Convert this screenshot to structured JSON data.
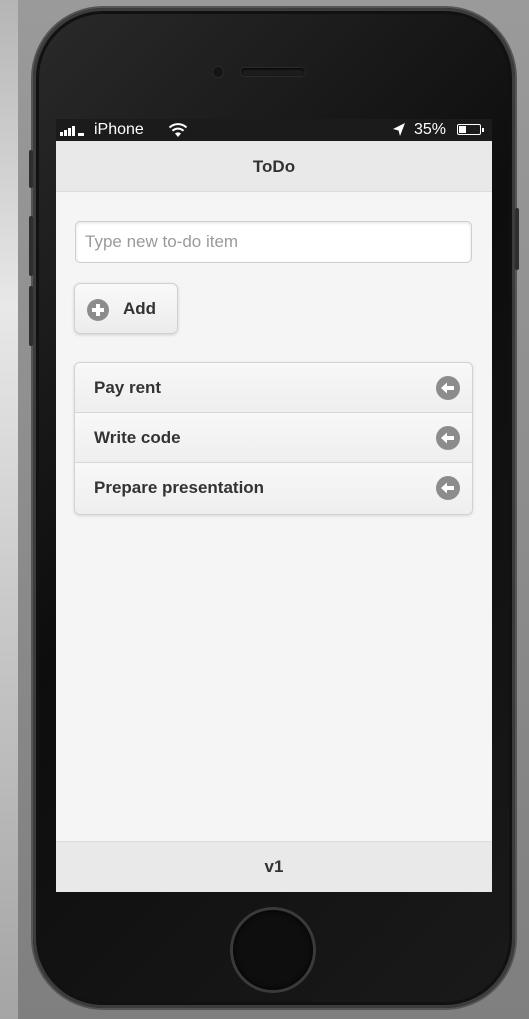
{
  "status_bar": {
    "carrier": "iPhone",
    "battery_percent": "35%",
    "battery_level": 0.35,
    "signal_icon": "signal-bars-icon",
    "wifi_icon": "wifi-icon",
    "location_icon": "location-arrow-icon",
    "battery_icon": "battery-icon"
  },
  "header": {
    "title": "ToDo"
  },
  "new_item": {
    "placeholder": "Type new to-do item",
    "value": ""
  },
  "add_button": {
    "label": "Add",
    "icon": "plus-circle-icon"
  },
  "todo_items": [
    {
      "label": "Pay rent",
      "icon": "arrow-left-circle-icon"
    },
    {
      "label": "Write code",
      "icon": "arrow-left-circle-icon"
    },
    {
      "label": "Prepare presentation",
      "icon": "arrow-left-circle-icon"
    }
  ],
  "footer": {
    "label": "v1"
  },
  "colors": {
    "screen_bg": "#f5f5f5",
    "bar_bg": "#e9e9e9",
    "icon_gray": "#8c8c8c",
    "text": "#333333"
  }
}
